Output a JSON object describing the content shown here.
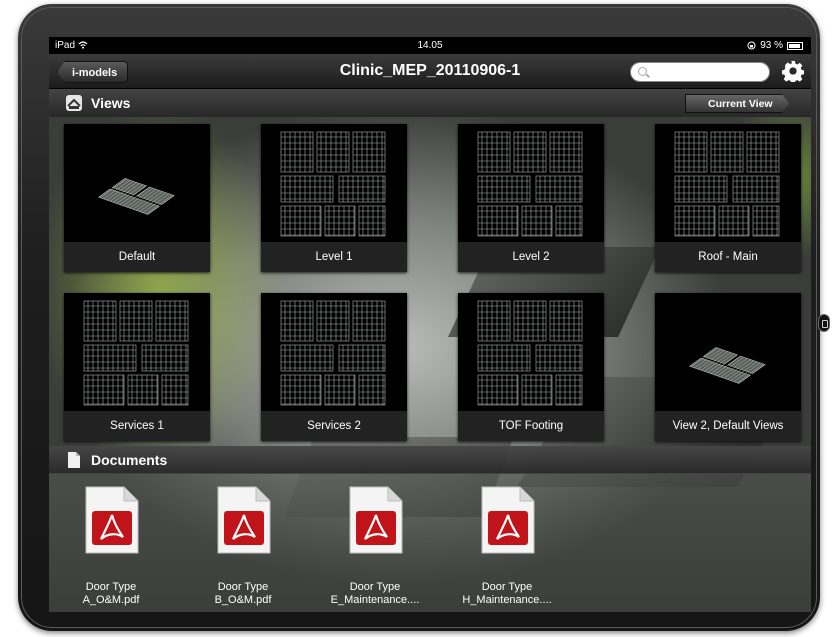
{
  "status_bar": {
    "device": "iPad",
    "time": "14.05",
    "battery": "93 %"
  },
  "nav": {
    "back_label": "i-models",
    "title": "Clinic_MEP_20110906-1"
  },
  "views_section": {
    "title": "Views",
    "current_view_label": "Current View"
  },
  "views": [
    {
      "label": "Default",
      "thumb": "iso-3d"
    },
    {
      "label": "Level 1",
      "thumb": "plan"
    },
    {
      "label": "Level 2",
      "thumb": "plan"
    },
    {
      "label": "Roof - Main",
      "thumb": "plan"
    },
    {
      "label": "Services 1",
      "thumb": "plan"
    },
    {
      "label": "Services 2",
      "thumb": "plan"
    },
    {
      "label": "TOF Footing",
      "thumb": "plan"
    },
    {
      "label": "View 2, Default Views",
      "thumb": "iso-3d"
    }
  ],
  "documents_section": {
    "title": "Documents"
  },
  "documents": [
    {
      "line1": "Door Type",
      "line2": "A_O&M.pdf"
    },
    {
      "line1": "Door Type",
      "line2": "B_O&M.pdf"
    },
    {
      "line1": "Door Type",
      "line2": "E_Maintenance...."
    },
    {
      "line1": "Door Type",
      "line2": "H_Maintenance...."
    }
  ],
  "colors": {
    "pdf_red": "#c0141a",
    "accent_green": "#a6d13a"
  }
}
